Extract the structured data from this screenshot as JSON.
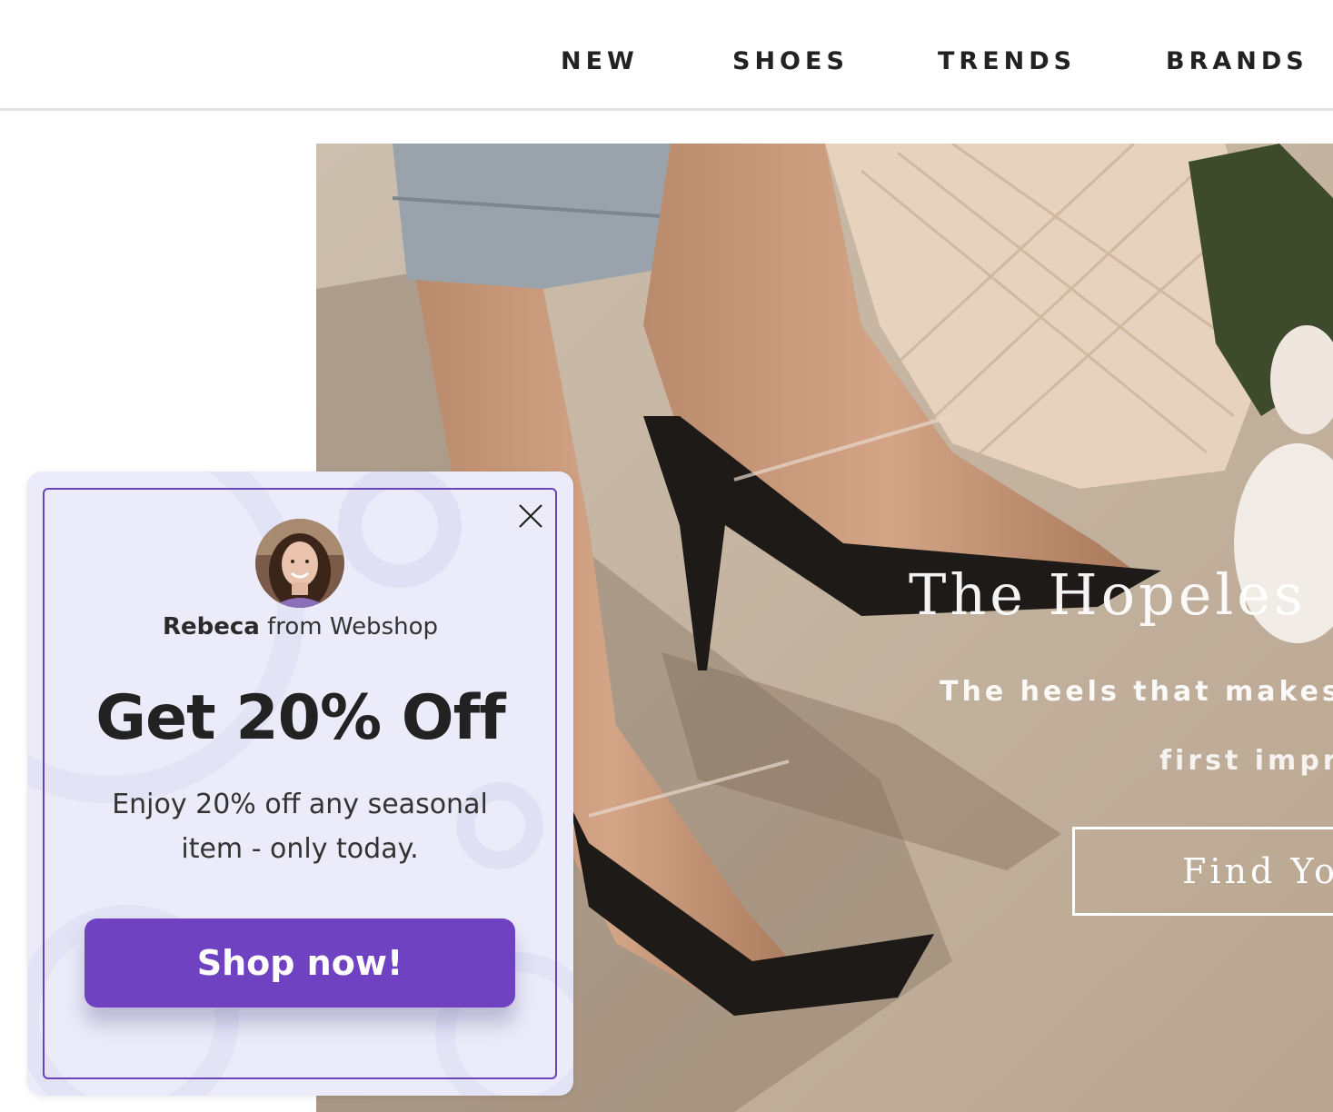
{
  "nav": {
    "items": [
      "NEW",
      "SHOES",
      "TRENDS",
      "BRANDS"
    ]
  },
  "hero": {
    "title": "The Hopeles",
    "subtitle_line1": "The heels that makes",
    "subtitle_line2": "first impr",
    "cta_label": "Find Yo"
  },
  "popup": {
    "sender_name": "Rebeca",
    "sender_suffix": " from Webshop",
    "headline": "Get 20% Off",
    "description": "Enjoy 20% off any seasonal item - only today.",
    "button_label": "Shop now!",
    "close_icon": "close-icon",
    "accent_color": "#6f42c1"
  }
}
